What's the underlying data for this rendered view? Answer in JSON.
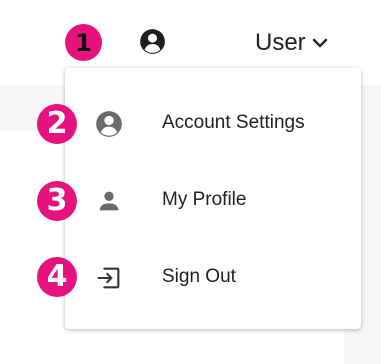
{
  "header": {
    "user_label": "User",
    "account_icon": "account-circle-icon",
    "toggle_icon": "chevron-down-icon"
  },
  "markers": [
    "1",
    "2",
    "3",
    "4"
  ],
  "menu": {
    "items": [
      {
        "label": "Account Settings",
        "icon": "account-circle-icon"
      },
      {
        "label": "My Profile",
        "icon": "person-icon"
      },
      {
        "label": "Sign Out",
        "icon": "sign-out-icon"
      }
    ]
  },
  "colors": {
    "marker": "#e6137f",
    "icon_gray": "#6b6b6b",
    "icon_dark": "#1f1f1f",
    "text": "#222222"
  }
}
